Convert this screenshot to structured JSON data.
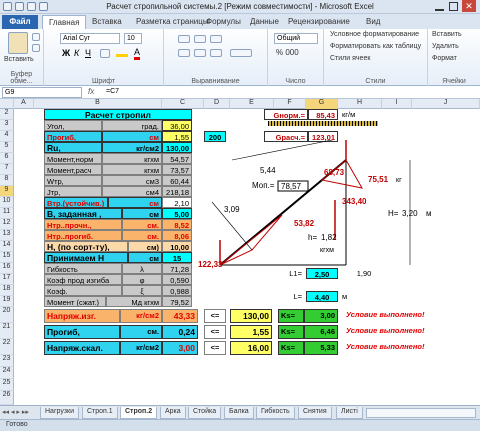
{
  "window": {
    "title": "Расчет стропильной системы.2  [Режим совместимости] - Microsoft Excel"
  },
  "ribbon_tabs": [
    "Файл",
    "Главная",
    "Вставка",
    "Разметка страницы",
    "Формулы",
    "Данные",
    "Рецензирование",
    "Вид"
  ],
  "ribbon": {
    "paste": "Вставить",
    "clipboard": "Буфер обме...",
    "font_name": "Arial Cyr",
    "font_size": "10",
    "font_group": "Шрифт",
    "align_group": "Выравнивание",
    "number_format": "Общий",
    "number_group": "Число",
    "cond_format": "Условное форматирование",
    "format_table": "Форматировать как таблицу",
    "cell_styles": "Стили ячеек",
    "styles_group": "Стили",
    "cells_group": "Ячейки",
    "insert": "Вставить",
    "delete": "Удалить",
    "format": "Формат"
  },
  "formula_bar": {
    "name_box": "G9",
    "fx": "fx",
    "formula": "=C7"
  },
  "columns": [
    "A",
    "B",
    "C",
    "D",
    "E",
    "F",
    "G",
    "H",
    "I",
    "J"
  ],
  "rows": [
    "2",
    "3",
    "4",
    "5",
    "6",
    "7",
    "8",
    "9",
    "10",
    "11",
    "12",
    "13",
    "14",
    "15",
    "16",
    "17",
    "18",
    "19",
    "20",
    "21",
    "22",
    "23",
    "24",
    "25",
    "26"
  ],
  "table": {
    "title": "Расчет стропил",
    "angle_label": "Угол,",
    "angle_unit": "град.",
    "angle_value": "36,00",
    "deflection_label": "Прогиб,",
    "deflection_unit": "см",
    "deflection_value": "1,55",
    "deflection_limit": "200",
    "ru_label": "Ru,",
    "ru_unit": "кг/см2",
    "ru_value": "130,00",
    "moment_norm_label": "Момент,норм",
    "moment_norm_unit": "кгхм",
    "moment_norm_value": "54,57",
    "moment_calc_label": "Момент,расч",
    "moment_calc_unit": "кгхм",
    "moment_calc_value": "73,57",
    "wtr_label": "Wтр,",
    "wtr_unit": "см3",
    "wtr_value": "60,44",
    "jtr_label": "Jтр,",
    "jtr_unit": "см4",
    "jtr_value": "218,18",
    "vtr_label": "Втр.(устойчив.)",
    "vtr_unit": "см",
    "vtr_value": "2,10",
    "b_label": "В, заданная ,",
    "b_unit": "см",
    "b_value": "5,00",
    "h_str_label": "Нтр..прочн.,",
    "h_str_unit": "см.",
    "h_str_value": "8,52",
    "h_defl_label": "Нтр..прогиб.",
    "h_defl_unit": "см.",
    "h_defl_value": "8,06",
    "h_sort_label": "Н, (по сорт-ту),",
    "h_sort_unit": "см)",
    "h_sort_value": "10,00",
    "accept_label": "Принимаем Н",
    "accept_unit": "см",
    "accept_value": "15",
    "flex_label": "Гибкость",
    "flex_sym": "λ",
    "flex_value": "71,28",
    "buck_label": "Коэф прод изгиба",
    "buck_sym": "φ",
    "buck_value": "0,590",
    "coef_label": "Коэф.",
    "coef_sym": "ξ",
    "coef_value": "0,988",
    "moment_cj_label": "Момент (сжат.)",
    "moment_cj_unit": "Мд кгхм",
    "moment_cj_value": "79,52"
  },
  "checks": [
    {
      "label": "Напряж.изг.",
      "unit": "кг/см2",
      "value": "43,33",
      "op": "<=",
      "limit": "130,00",
      "ks_label": "Ks=",
      "ks_value": "3,00",
      "result": "Условие выполнено!"
    },
    {
      "label": "Прогиб,",
      "unit": "см.",
      "value": "0,24",
      "op": "<=",
      "limit": "1,55",
      "ks_label": "Ks=",
      "ks_value": "6,46",
      "result": "Условие выполнено!"
    },
    {
      "label": "Напряж.скал.",
      "unit": "кг/см2",
      "value": "3,00",
      "op": "<=",
      "limit": "16,00",
      "ks_label": "Ks=",
      "ks_value": "5,33",
      "result": "Условие выполнено!"
    }
  ],
  "loads": {
    "gnorm_label": "Gнорм.=",
    "gnorm_value": "85,43",
    "gnorm_unit": "кг/м",
    "gcalc_label": "Gрасч.=",
    "gcalc_value": "123,01"
  },
  "diagram": {
    "len_top": "5,44",
    "len_mid": "3,09",
    "h_label": "h=",
    "h_value": "1,82",
    "h_unit": "кгхм",
    "H_label": "Н=",
    "H_value": "3,20",
    "H_unit": "м",
    "mop_label": "Моп.=",
    "mop_value": "78,57",
    "force_a": "68,73",
    "force_b": "343,40",
    "force_c": "75,51",
    "force_c_unit": "кг",
    "force_d": "53,82",
    "force_e": "122,33",
    "L1_label": "L1=",
    "L1_value": "2,50",
    "L1_extra": "1,90",
    "L_label": "L=",
    "L_value": "4,40",
    "L_unit": "м"
  },
  "sheet_tabs": [
    "Нагрузки",
    "Строп.1",
    "Строп.2",
    "Арка",
    "Стойка",
    "Балка",
    "Гибкость",
    "Снятия",
    "Листі"
  ],
  "active_sheet": "Строп.2",
  "status": "Готово",
  "colors": {
    "ribbon": "#dbe5f1",
    "file_tab": "#2a66b0",
    "yellow": "#ffff66",
    "cyan": "#00ffff",
    "orange": "#fab36a",
    "green": "#33cc33",
    "red": "#e00000"
  }
}
